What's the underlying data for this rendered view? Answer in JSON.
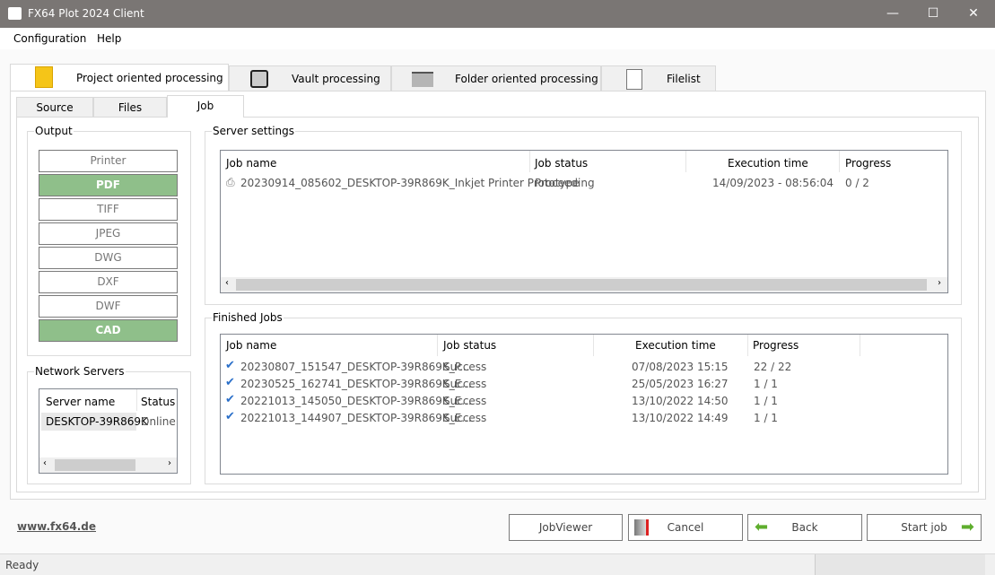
{
  "window": {
    "title": "FX64 Plot 2024 Client"
  },
  "menu": [
    "Configuration",
    "Help"
  ],
  "top_tabs": [
    "Project oriented processing",
    "Vault processing",
    "Folder oriented processing",
    "Filelist"
  ],
  "inner_tabs": [
    "Source",
    "Files",
    "Job"
  ],
  "output": {
    "title": "Output",
    "buttons": [
      {
        "label": "Printer",
        "selected": false
      },
      {
        "label": "PDF",
        "selected": true
      },
      {
        "label": "TIFF",
        "selected": false
      },
      {
        "label": "JPEG",
        "selected": false
      },
      {
        "label": "DWG",
        "selected": false
      },
      {
        "label": "DXF",
        "selected": false
      },
      {
        "label": "DWF",
        "selected": false
      },
      {
        "label": "CAD",
        "selected": true
      }
    ]
  },
  "network": {
    "title": "Network Servers",
    "headers": [
      "Server name",
      "Status"
    ],
    "rows": [
      [
        "DESKTOP-39R869K",
        "Online"
      ]
    ]
  },
  "server": {
    "title": "Server settings",
    "headers": [
      "Job name",
      "Job status",
      "Execution time",
      "Progress"
    ],
    "rows": [
      [
        "20230914_085602_DESKTOP-39R869K_Inkjet Printer Prototype",
        "Proceeding",
        "14/09/2023 - 08:56:04",
        "0 / 2"
      ]
    ]
  },
  "finished": {
    "title": "Finished Jobs",
    "headers": [
      "Job name",
      "Job status",
      "Execution time",
      "Progress"
    ],
    "rows": [
      [
        "20230807_151547_DESKTOP-39R869K_P...",
        "Success",
        "07/08/2023 15:15",
        "22 / 22"
      ],
      [
        "20230525_162741_DESKTOP-39R869K_E...",
        "Success",
        "25/05/2023 16:27",
        "1 / 1"
      ],
      [
        "20221013_145050_DESKTOP-39R869K_E...",
        "Success",
        "13/10/2022 14:50",
        "1 / 1"
      ],
      [
        "20221013_144907_DESKTOP-39R869K_E...",
        "Success",
        "13/10/2022 14:49",
        "1 / 1"
      ]
    ]
  },
  "footer": {
    "link": "www.fx64.de",
    "jobviewer": "JobViewer",
    "cancel": "Cancel",
    "back": "Back",
    "start": "Start job"
  },
  "status": {
    "text": "Ready"
  },
  "colors": {
    "selected_output": "#8fbf8a",
    "check": "#2a6fc9"
  }
}
